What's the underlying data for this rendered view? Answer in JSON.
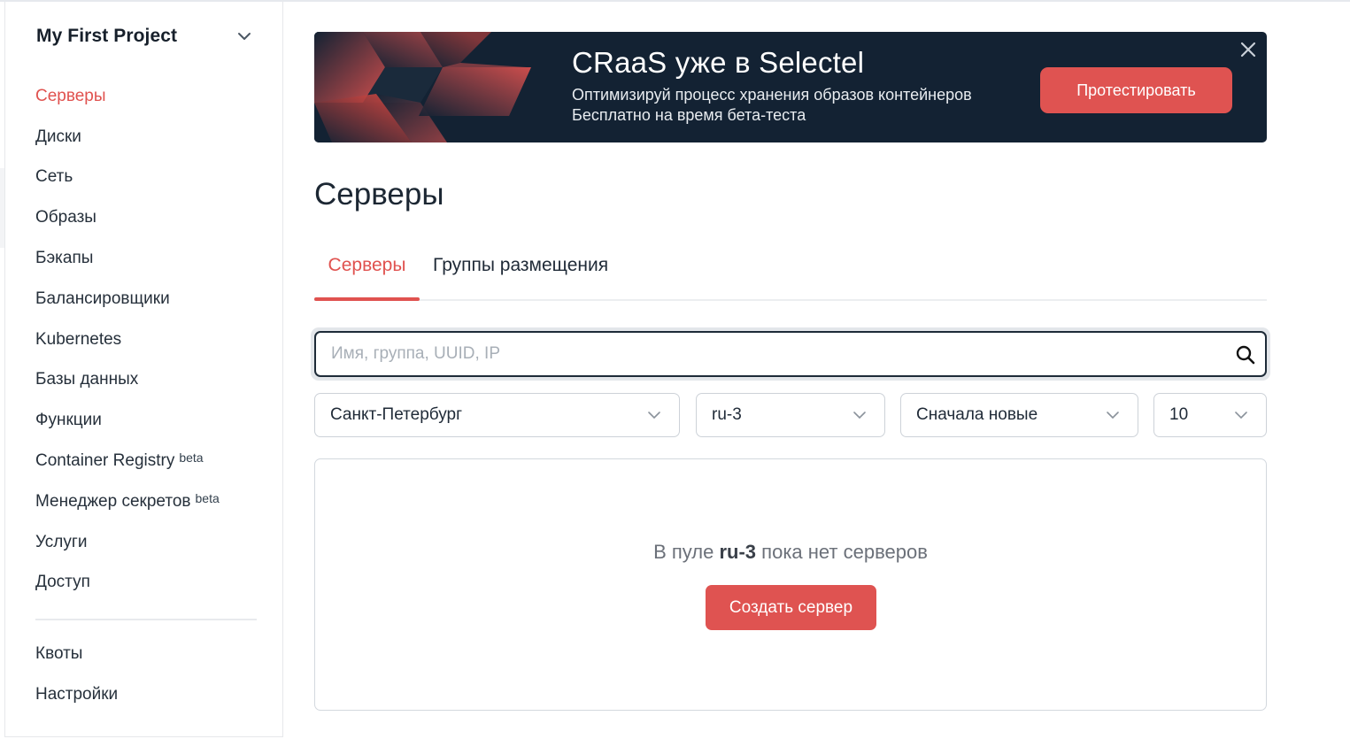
{
  "sidebar": {
    "project_name": "My First Project",
    "items": [
      {
        "label": "Серверы",
        "active": true,
        "badge": ""
      },
      {
        "label": "Диски",
        "badge": ""
      },
      {
        "label": "Сеть",
        "badge": ""
      },
      {
        "label": "Образы",
        "badge": ""
      },
      {
        "label": "Бэкапы",
        "badge": ""
      },
      {
        "label": "Балансировщики",
        "badge": ""
      },
      {
        "label": "Kubernetes",
        "badge": ""
      },
      {
        "label": "Базы данных",
        "badge": ""
      },
      {
        "label": "Функции",
        "badge": ""
      },
      {
        "label": "Container Registry",
        "badge": "beta"
      },
      {
        "label": "Менеджер секретов",
        "badge": "beta"
      },
      {
        "label": "Услуги",
        "badge": ""
      },
      {
        "label": "Доступ",
        "badge": ""
      }
    ],
    "secondary_items": [
      {
        "label": "Квоты"
      },
      {
        "label": "Настройки"
      }
    ]
  },
  "banner": {
    "title": "CRaaS уже в Selectel",
    "line1": "Оптимизируй процесс хранения образов контейнеров",
    "line2": "Бесплатно на время бета-теста",
    "button_label": "Протестировать",
    "close_icon": "close-icon"
  },
  "page": {
    "title": "Серверы",
    "tabs": [
      {
        "label": "Серверы",
        "active": true
      },
      {
        "label": "Группы размещения",
        "active": false
      }
    ]
  },
  "filters": {
    "search_placeholder": "Имя, группа, UUID, IP",
    "search_value": "",
    "city": "Санкт-Петербург",
    "pool": "ru-3",
    "sort": "Сначала новые",
    "per_page": "10"
  },
  "empty_state": {
    "prefix": "В пуле",
    "pool": "ru-3",
    "suffix": "пока нет серверов",
    "button_label": "Создать сервер"
  },
  "colors": {
    "accent": "#e0524f",
    "banner_bg": "#132233",
    "text": "#1f2a37"
  }
}
